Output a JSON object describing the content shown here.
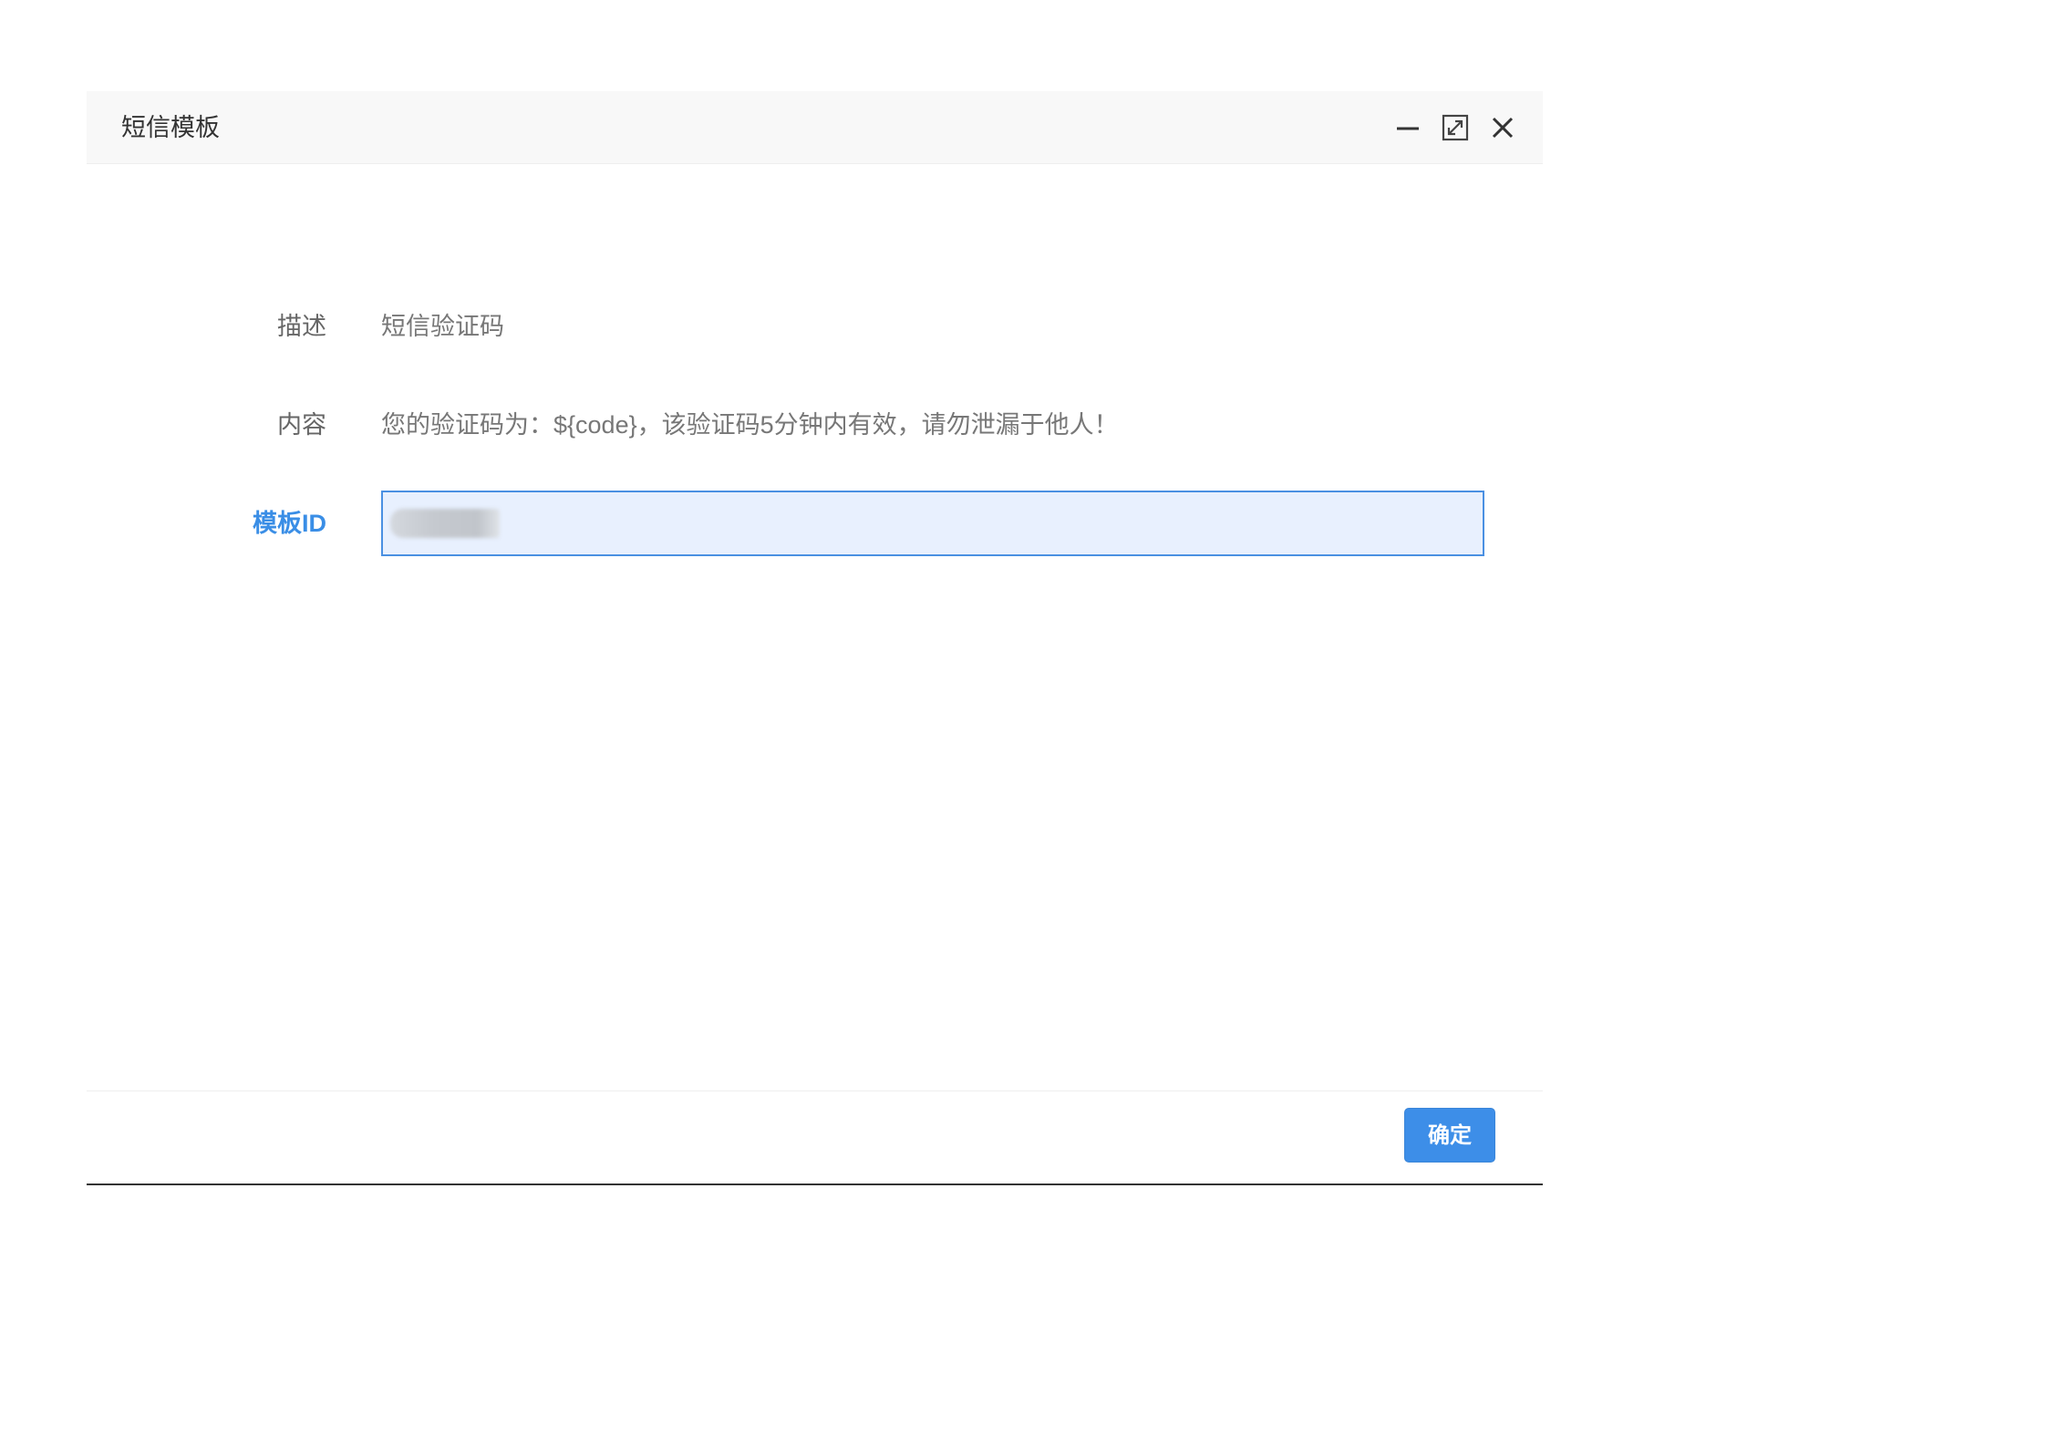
{
  "dialog": {
    "title": "短信模板",
    "icons": [
      "minimize-icon",
      "maximize-icon",
      "close-icon"
    ]
  },
  "form": {
    "description": {
      "label": "描述",
      "value": "短信验证码"
    },
    "content": {
      "label": "内容",
      "value": "您的验证码为：${code}，该验证码5分钟内有效，请勿泄漏于他人！"
    },
    "template_id": {
      "label": "模板ID",
      "value": ""
    }
  },
  "footer": {
    "confirm_label": "确定"
  },
  "colors": {
    "accent": "#3d8ee8",
    "active_label": "#3a8ee6",
    "input_bg": "#e8f0fe",
    "header_bg": "#f8f8f8"
  }
}
